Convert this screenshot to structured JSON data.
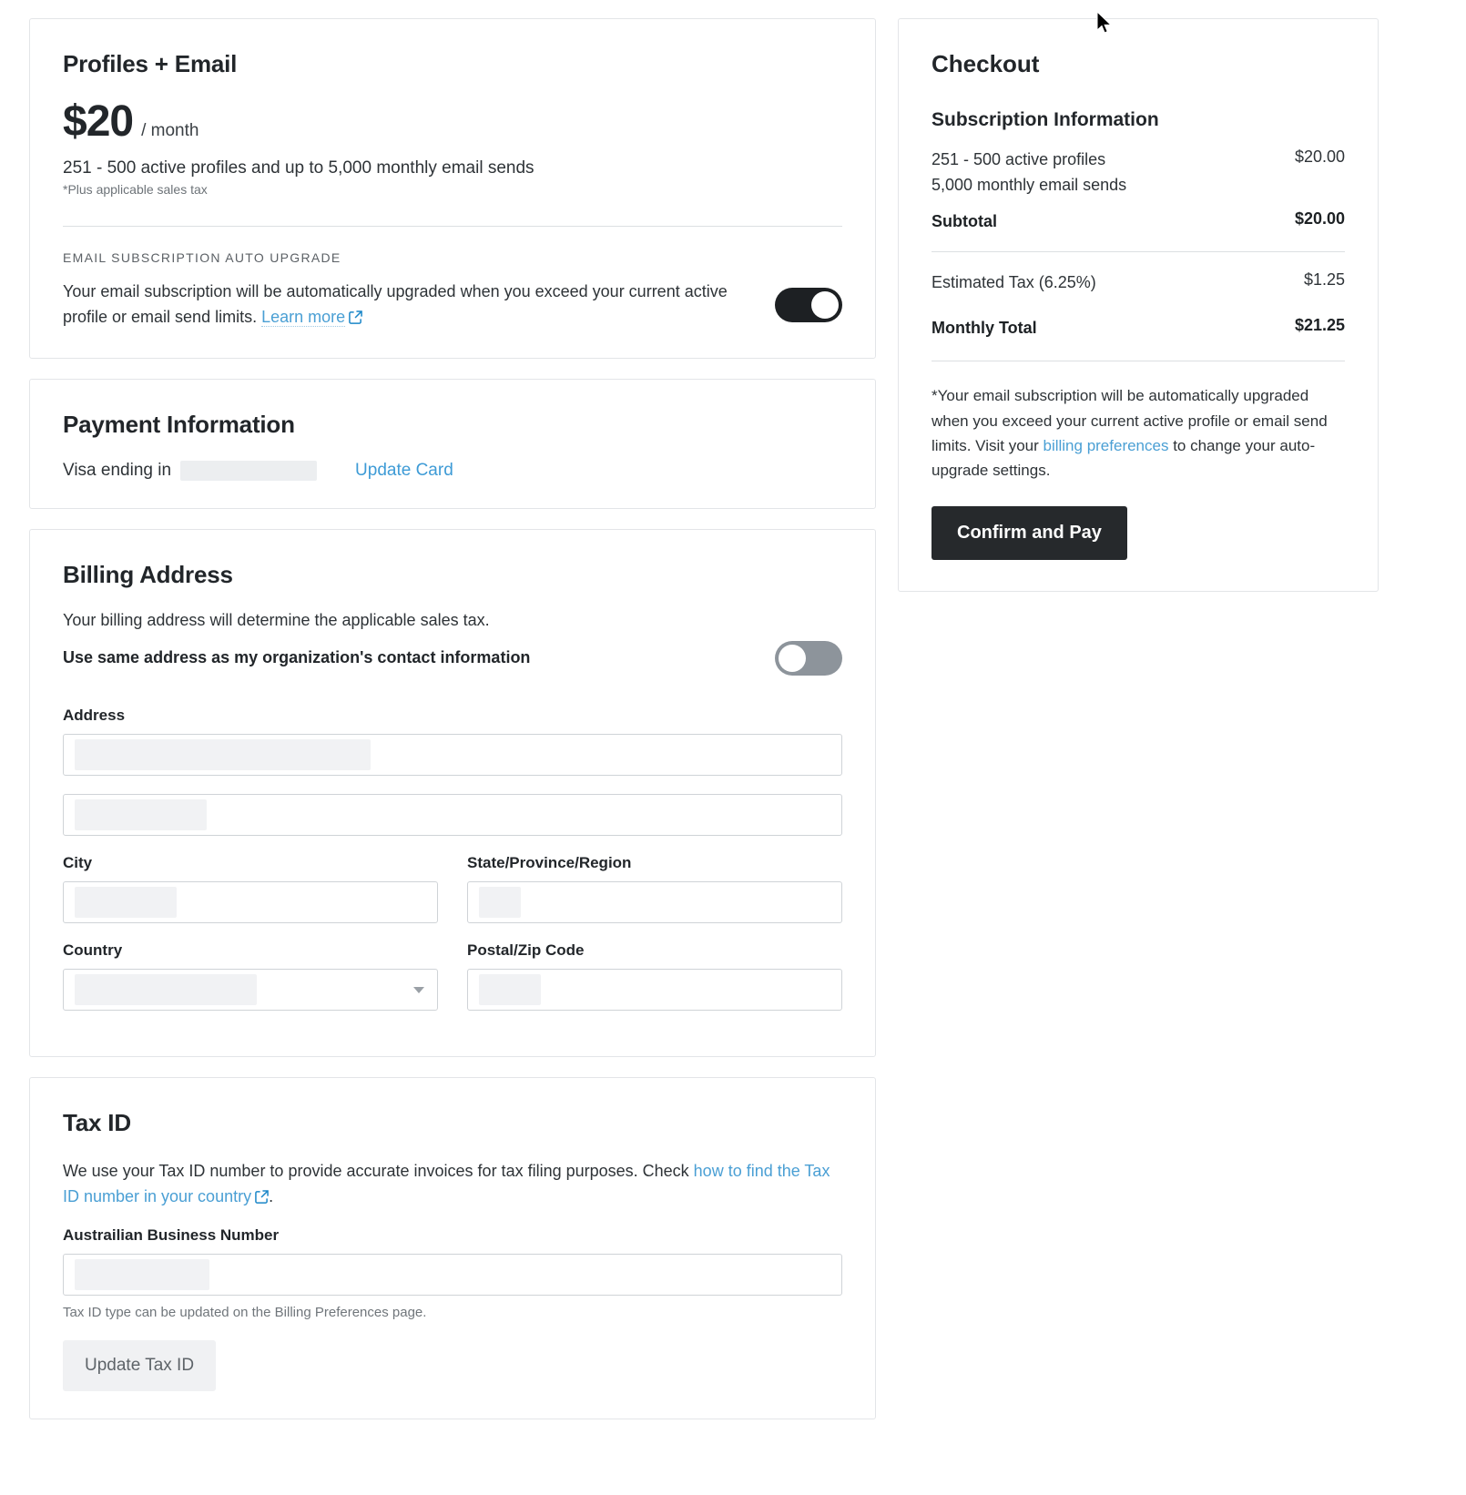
{
  "plan": {
    "title": "Profiles + Email",
    "price": "$20",
    "period": "/ month",
    "description": "251 - 500 active profiles and up to 5,000 monthly email sends",
    "tax_note": "*Plus applicable sales tax",
    "auto_upgrade": {
      "eyebrow": "EMAIL SUBSCRIPTION AUTO UPGRADE",
      "text": "Your email subscription will be automatically upgraded when you exceed your current active profile or email send limits.",
      "link_label": "Learn more",
      "toggle_state": "on"
    }
  },
  "payment": {
    "title": "Payment Information",
    "card_label": "Visa ending in",
    "card_value": "",
    "update_label": "Update Card"
  },
  "billing": {
    "title": "Billing Address",
    "description": "Your billing address will determine the applicable sales tax.",
    "same_address_label": "Use same address as my organization's contact information",
    "same_address_toggle": "off",
    "address_label": "Address",
    "address_line1_value": "",
    "address_line2_value": "",
    "city_label": "City",
    "city_value": "",
    "state_label": "State/Province/Region",
    "state_value": "",
    "country_label": "Country",
    "country_value": "",
    "postal_label": "Postal/Zip Code",
    "postal_value": ""
  },
  "tax_id": {
    "title": "Tax ID",
    "description_part1": "We use your Tax ID number to provide accurate invoices for tax filing purposes. Check ",
    "link_label": "how to find the Tax ID number in your country",
    "description_part2": ".",
    "field_label": "Austrailian Business Number",
    "field_value": "",
    "hint": "Tax ID type can be updated on the Billing Preferences page.",
    "button_label": "Update Tax ID"
  },
  "checkout": {
    "title": "Checkout",
    "subscription_heading": "Subscription Information",
    "items": [
      {
        "label_line1": "251 - 500 active profiles",
        "label_line2": "5,000 monthly email sends",
        "value": "$20.00"
      }
    ],
    "subtotal_label": "Subtotal",
    "subtotal_value": "$20.00",
    "tax_label": "Estimated Tax (6.25%)",
    "tax_value": "$1.25",
    "total_label": "Monthly Total",
    "total_value": "$21.25",
    "footnote_part1": "*Your email subscription will be automatically upgraded when you exceed your current active profile or email send limits. Visit your ",
    "footnote_link": "billing preferences",
    "footnote_part2": " to change your auto-upgrade settings.",
    "confirm_label": "Confirm and Pay"
  },
  "colors": {
    "link": "#4a9fd4",
    "toggle_on": "#1d2023",
    "toggle_off": "#8d949b",
    "primary_button": "#26292c"
  }
}
